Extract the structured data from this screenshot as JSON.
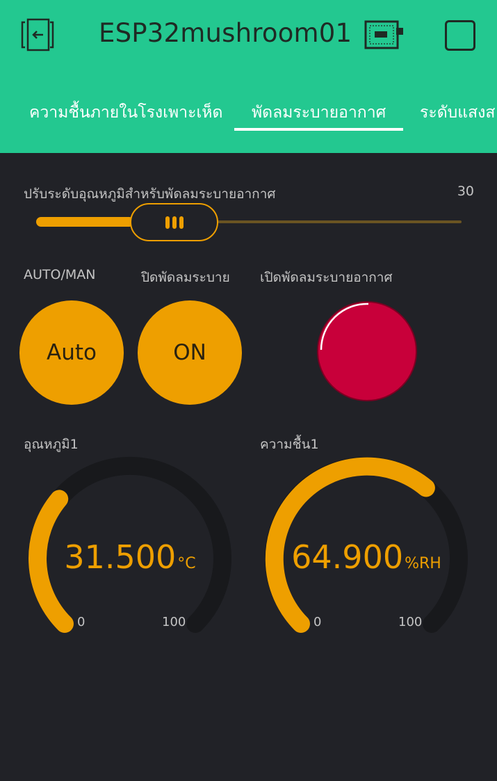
{
  "header": {
    "title": "ESP32mushroom01",
    "exit_icon": "exit-icon",
    "device_icon": "device-icon",
    "square_icon": "square-icon"
  },
  "tabs": [
    {
      "label": "ความชื้นภายในโรงเพาะเห็ด",
      "active": false
    },
    {
      "label": "พัดลมระบายอากาศ",
      "active": true
    },
    {
      "label": "ระดับแสงส",
      "active": false
    }
  ],
  "slider": {
    "label": "ปรับระดับอุณหภูมิสำหรับพัดลมระบายอากาศ",
    "value": "30",
    "fraction": 0.23
  },
  "buttons": {
    "auto_label": "AUTO/MAN",
    "auto_text": "Auto",
    "fan_off_label": "ปิดพัดลมระบาย",
    "fan_off_text": "ON"
  },
  "led": {
    "label": "เปิดพัดลมระบายอากาศ",
    "color": "#c8003a"
  },
  "gauges": [
    {
      "label": "อุณหภูมิ1",
      "value": "31.500",
      "unit": "°C",
      "min": "0",
      "max": "100",
      "fraction": 0.315
    },
    {
      "label": "ความชื้น1",
      "value": "64.900",
      "unit": "%RH",
      "min": "0",
      "max": "100",
      "fraction": 0.649
    }
  ],
  "colors": {
    "header_bg": "#23c890",
    "body_bg": "#212227",
    "accent": "#ee9f00",
    "led_red": "#c8003a"
  }
}
